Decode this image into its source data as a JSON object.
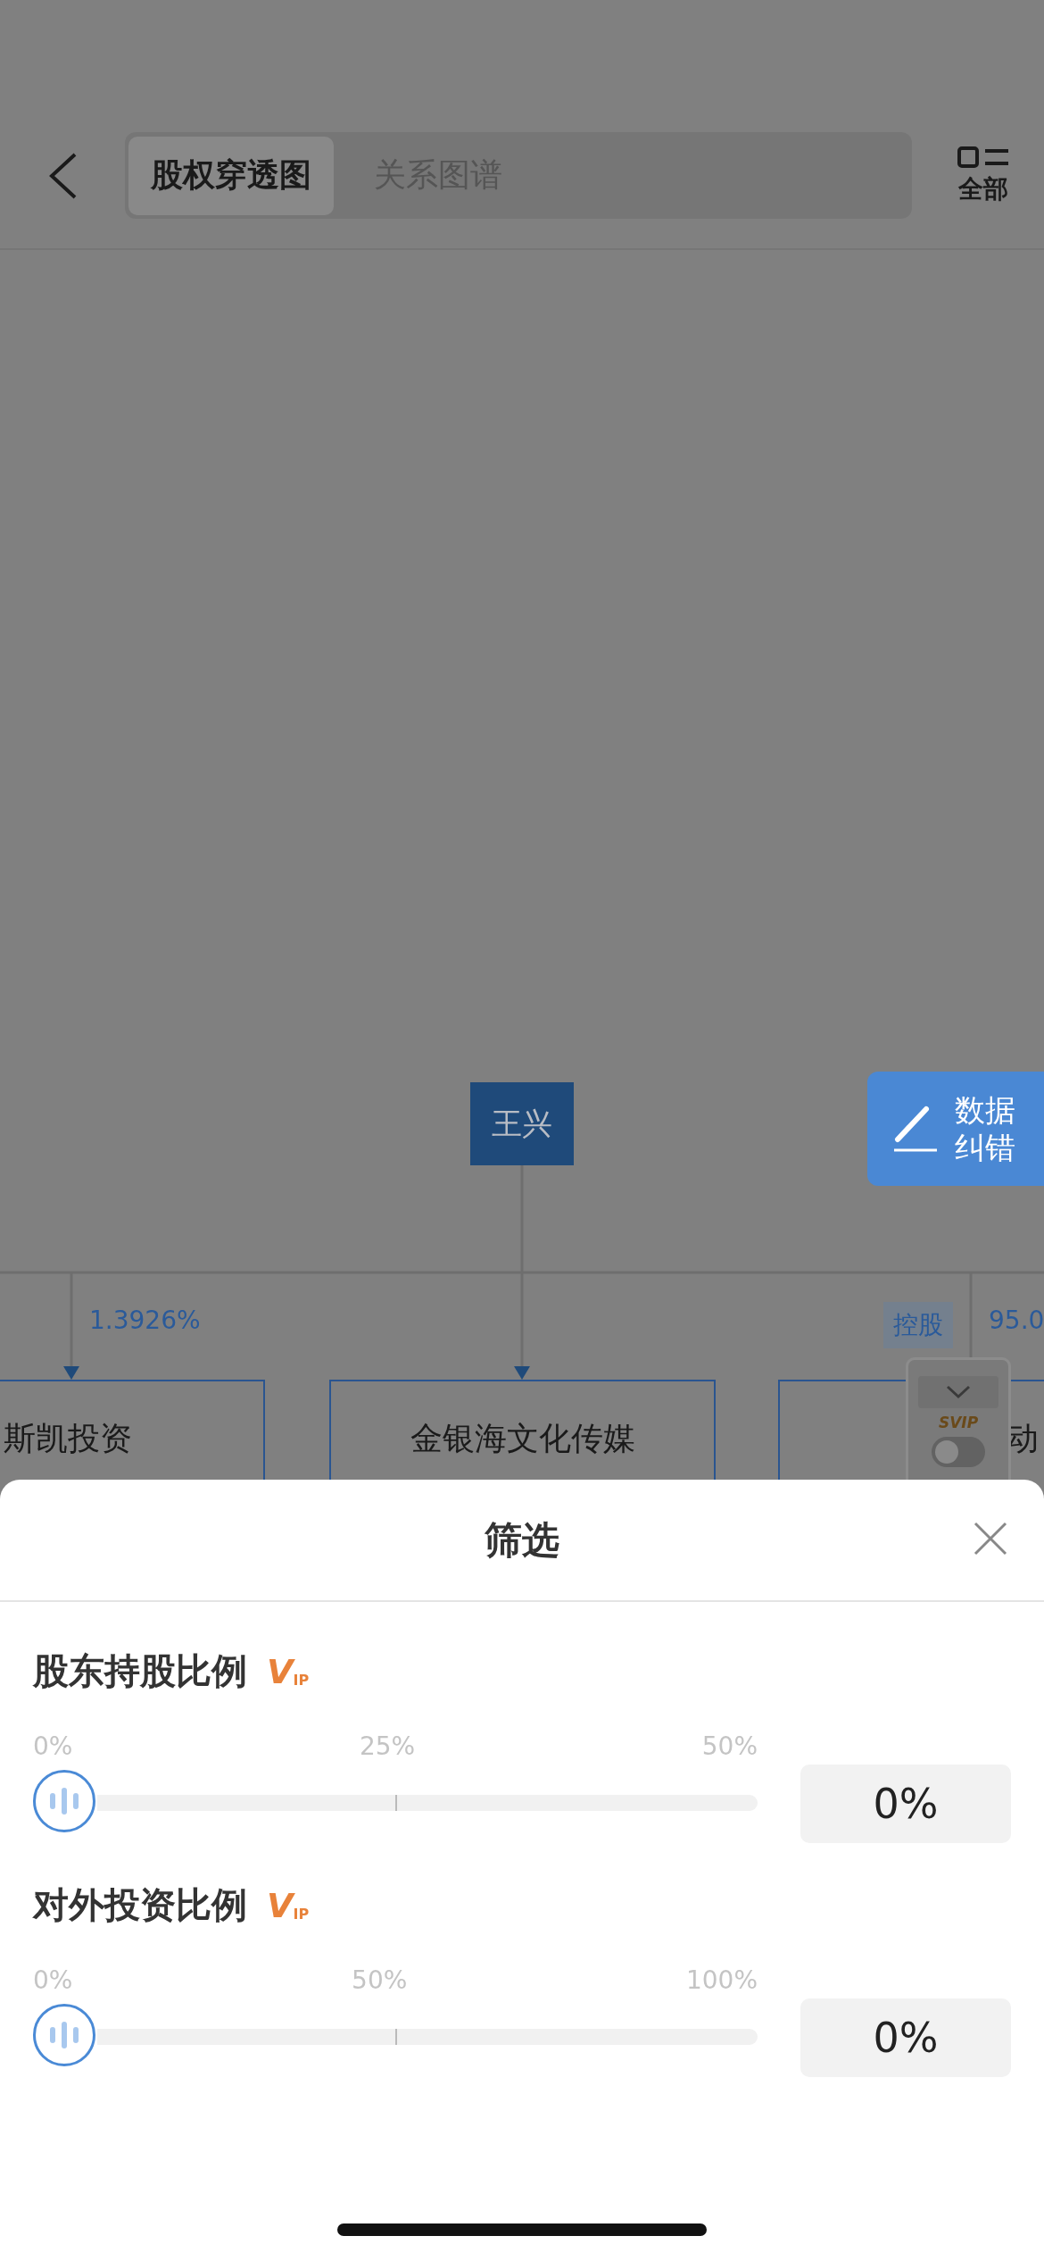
{
  "header": {
    "tabs": [
      {
        "label": "股权穿透图",
        "selected": true
      },
      {
        "label": "关系图谱",
        "selected": false
      }
    ],
    "filter_label": "全部"
  },
  "chart": {
    "root": "王兴",
    "companies": [
      {
        "name": "斯凯投资",
        "percent": "1.3926%"
      },
      {
        "name": "金银海文化传媒"
      },
      {
        "name": "动",
        "tag": "控股",
        "percent": "95.0"
      }
    ]
  },
  "correction_button": "数据纠错",
  "svip_panel": {
    "label": "SVIP",
    "on": false
  },
  "sheet": {
    "title": "筛选",
    "sections": [
      {
        "label": "股东持股比例",
        "badge": "V$_{IP}$",
        "ticks": [
          "0%",
          "25%",
          "50%"
        ],
        "value": "0%"
      },
      {
        "label": "对外投资比例",
        "badge": "V$_{IP}$",
        "ticks": [
          "0%",
          "50%",
          "100%"
        ],
        "value": "0%"
      }
    ]
  }
}
